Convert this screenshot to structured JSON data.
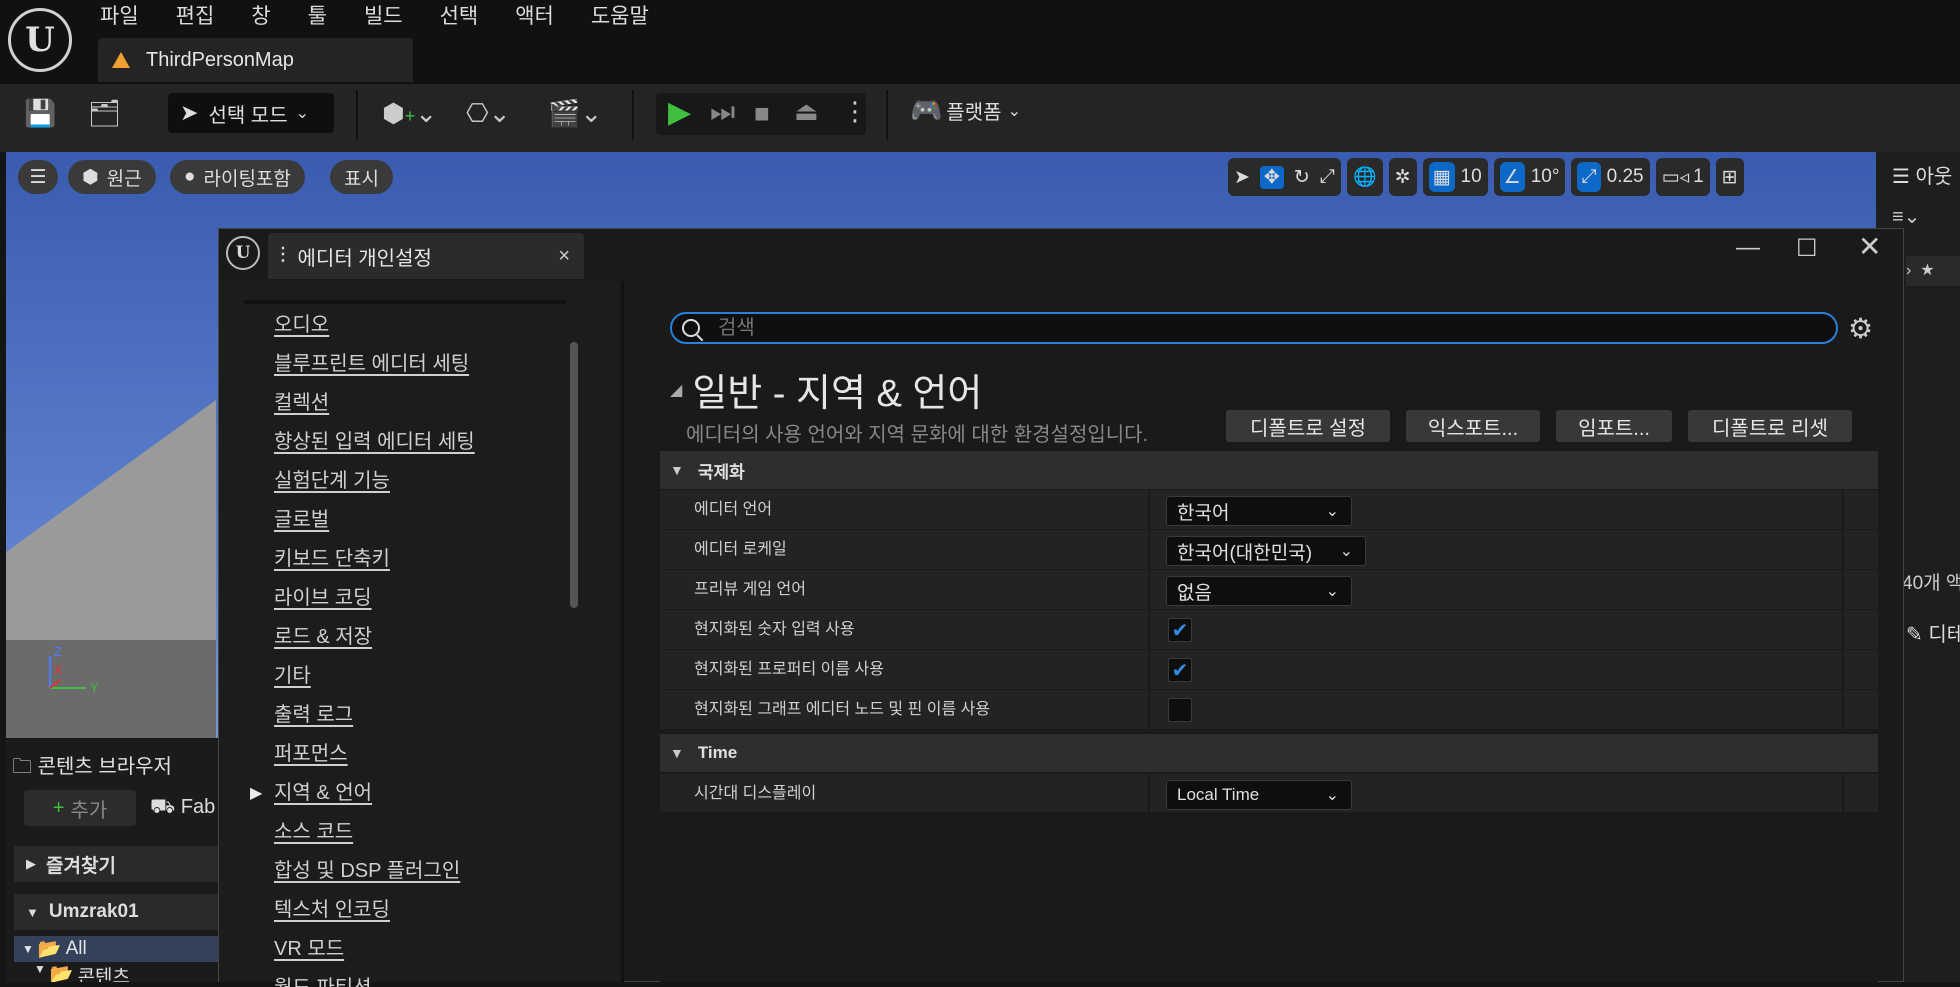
{
  "menu": [
    "파일",
    "편집",
    "창",
    "툴",
    "빌드",
    "선택",
    "액터",
    "도움말"
  ],
  "map_tab": "ThirdPersonMap",
  "toolbar": {
    "mode_label": "선택 모드",
    "platform_label": "플랫폼"
  },
  "viewport": {
    "perspective": "원근",
    "lighting": "라이팅포함",
    "show": "표시",
    "grid_snap": "10",
    "rot_snap": "10°",
    "scale_snap": "0.25",
    "camera_speed": "1"
  },
  "content_browser": {
    "title": "콘텐츠 브라우저",
    "add": "추가",
    "fab": "Fab",
    "favorites": "즐겨찾기",
    "project": "Umzrak01",
    "all": "All",
    "content": "콘텐츠"
  },
  "outliner": {
    "title": "아웃",
    "count": "40개 액",
    "details": "디테"
  },
  "dialog": {
    "tab_title": "에디터 개인설정",
    "nav": [
      "오디오",
      "블루프린트 에디터 세팅",
      "컬렉션",
      "향상된 입력 에디터 세팅",
      "실험단계 기능",
      "글로벌",
      "키보드 단축키",
      "라이브 코딩",
      "로드 & 저장",
      "기타",
      "출력 로그",
      "퍼포먼스",
      "지역 & 언어",
      "소스 코드",
      "합성 및 DSP 플러그인",
      "텍스처 인코딩",
      "VR 모드",
      "월드 파티션"
    ],
    "selected_nav": "지역 & 언어",
    "search_placeholder": "검색",
    "section_title": "일반 - 지역 & 언어",
    "section_desc": "에디터의 사용 언어와 지역 문화에 대한 환경설정입니다.",
    "buttons": [
      "디폴트로 설정",
      "익스포트...",
      "임포트...",
      "디폴트로 리셋"
    ],
    "categories": {
      "intl": {
        "title": "국제화",
        "rows": [
          {
            "name": "에디터 언어",
            "value": "한국어"
          },
          {
            "name": "에디터 로케일",
            "value": "한국어(대한민국)"
          },
          {
            "name": "프리뷰 게임 언어",
            "value": "없음"
          },
          {
            "name": "현지화된 숫자 입력 사용",
            "checked": true
          },
          {
            "name": "현지화된 프로퍼티 이름 사용",
            "checked": true
          },
          {
            "name": "현지화된 그래프 에디터 노드 및 핀 이름 사용",
            "checked": false
          }
        ]
      },
      "time": {
        "title": "Time",
        "rows": [
          {
            "name": "시간대 디스플레이",
            "value": "Local Time"
          }
        ]
      }
    }
  },
  "colors": {
    "accent": "#0d69c8",
    "play": "#3fbf3f",
    "warning": "#f0a030"
  }
}
